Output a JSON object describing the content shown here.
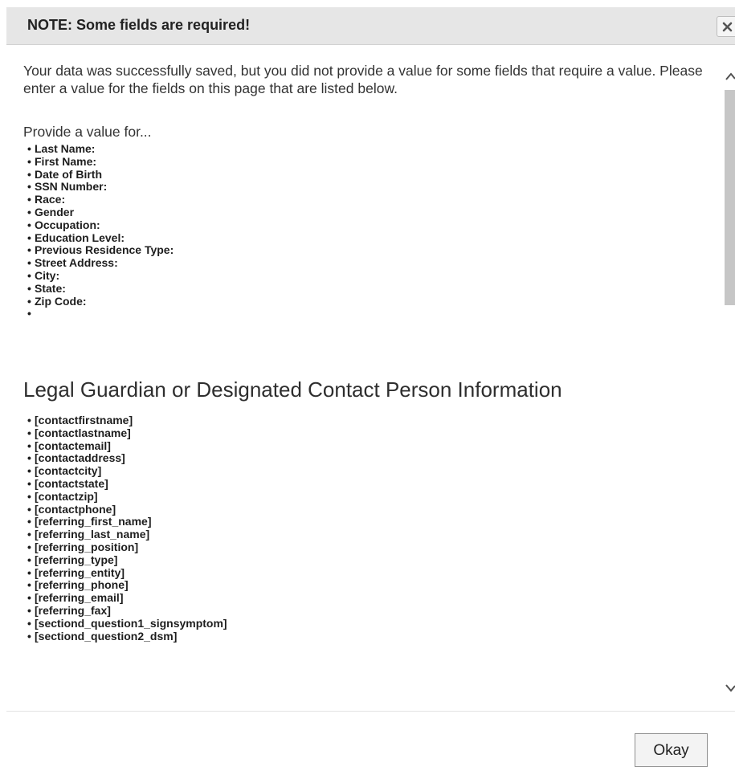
{
  "dialog": {
    "title": "NOTE: Some fields are required!",
    "close_icon": "close-x-icon",
    "intro_text": "Your data was successfully saved, but you did not provide a value for some fields that require a value. Please enter a value for the fields on this page that are listed below.",
    "provide_label": "Provide a value for...",
    "bullet": "•",
    "fields": [
      "Last Name:",
      "First Name:",
      "Date of Birth",
      "SSN Number:",
      "Race:",
      "Gender",
      "Occupation:",
      "Education Level:",
      "Previous Residence Type:",
      "Street Address:",
      "City:",
      "State:",
      "Zip Code:",
      ""
    ],
    "section_heading": "Legal Guardian or Designated Contact Person Information",
    "contact_fields": [
      "[contactfirstname]",
      "[contactlastname]",
      "[contactemail]",
      "[contactaddress]",
      "[contactcity]",
      "[contactstate]",
      "[contactzip]",
      "[contactphone]",
      "[referring_first_name]",
      "[referring_last_name]",
      "[referring_position]",
      "[referring_type]",
      "[referring_entity]",
      "[referring_phone]",
      "[referring_email]",
      "[referring_fax]",
      "[sectiond_question1_signsymptom]",
      "[sectiond_question2_dsm]"
    ],
    "okay_label": "Okay"
  }
}
